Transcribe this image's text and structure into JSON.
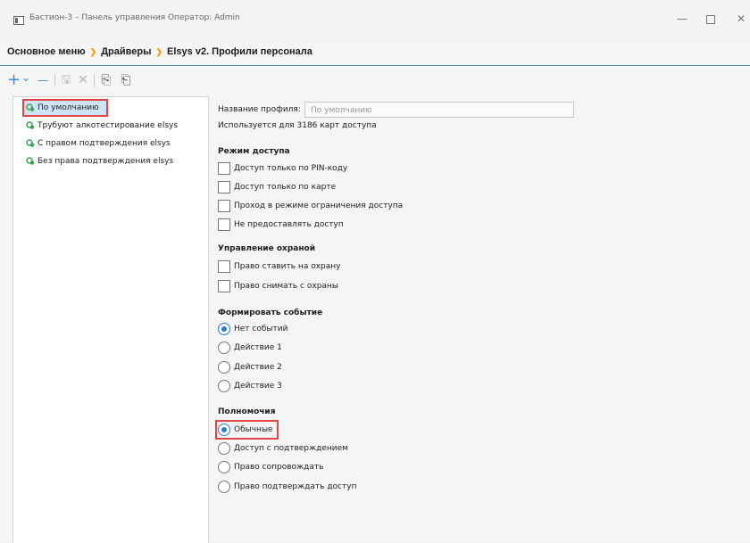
{
  "window": {
    "title": "Бастион-3 – Панель управления Оператор: Admin",
    "controls": {
      "minimize": "—",
      "maximize": "",
      "close": "✕"
    }
  },
  "breadcrumb": {
    "items": [
      "Основное меню",
      "Драйверы",
      "Elsys v2. Профили персонала"
    ],
    "separator": "❯"
  },
  "toolbar": {
    "add": "+",
    "dropdown": "⌄",
    "remove": "—",
    "save": "🖫",
    "delete": "✕",
    "copy": "⎘",
    "paste": "⎗"
  },
  "tree": {
    "items": [
      {
        "label": "По умолчанию",
        "selected": true
      },
      {
        "label": "Трубуют алкотестирование elsys",
        "selected": false
      },
      {
        "label": "С правом подтверждения elsys",
        "selected": false
      },
      {
        "label": "Без права подтверждения elsys",
        "selected": false
      }
    ]
  },
  "form": {
    "profile_name_label": "Название профиля:",
    "profile_name_value": "По умолчанию",
    "usage_text": "Используется для 3186 карт доступа",
    "access_mode": {
      "title": "Режим доступа",
      "options": [
        "Доступ только по PIN-коду",
        "Доступ только по карте",
        "Проход в режиме ограничения доступа",
        "Не предоставлять доступ"
      ]
    },
    "security": {
      "title": "Управление охраной",
      "options": [
        "Право ставить на охрану",
        "Право снимать с охраны"
      ]
    },
    "event": {
      "title": "Формировать событие",
      "options": [
        "Нет событий",
        "Действие 1",
        "Действие 2",
        "Действие 3"
      ],
      "selected": "Нет событий"
    },
    "authority": {
      "title": "Полномочия",
      "options": [
        "Обычные",
        "Доступ с подтверждением",
        "Право сопровождать",
        "Право подтверждать доступ"
      ],
      "selected": "Обычные"
    }
  },
  "colors": {
    "accent": "#2e7bd4",
    "toolbar_icon": "#3a8fd9",
    "breadcrumb_separator": "#f0a000",
    "highlight": "#e04646",
    "tree_icon": "#3aa655"
  }
}
